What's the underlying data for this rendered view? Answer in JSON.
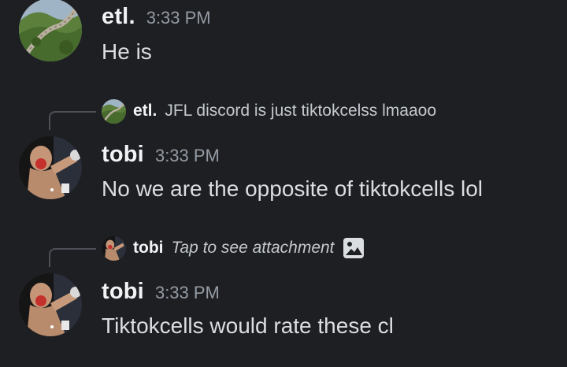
{
  "messages": [
    {
      "author": "etl.",
      "time": "3:33 PM",
      "text": "He is",
      "avatar_icon": "great-wall-avatar"
    },
    {
      "reply_to": {
        "author": "etl.",
        "text": "JFL discord is just tiktokcelss lmaaoo",
        "avatar_icon": "great-wall-avatar"
      },
      "author": "tobi",
      "time": "3:33 PM",
      "text": "No we are the opposite of tiktokcells lol",
      "avatar_icon": "boxer-avatar"
    },
    {
      "reply_to": {
        "author": "tobi",
        "text": "Tap to see attachment",
        "avatar_icon": "boxer-avatar",
        "attachment_icon": "image-icon"
      },
      "author": "tobi",
      "time": "3:33 PM",
      "text": "Tiktokcells would rate these cl",
      "avatar_icon": "boxer-avatar"
    }
  ],
  "colors": {
    "background": "#1e1f22",
    "username": "#f2f3f5",
    "timestamp": "#949ba4",
    "message_text": "#dbdee1",
    "reply_line": "#4e5058"
  }
}
